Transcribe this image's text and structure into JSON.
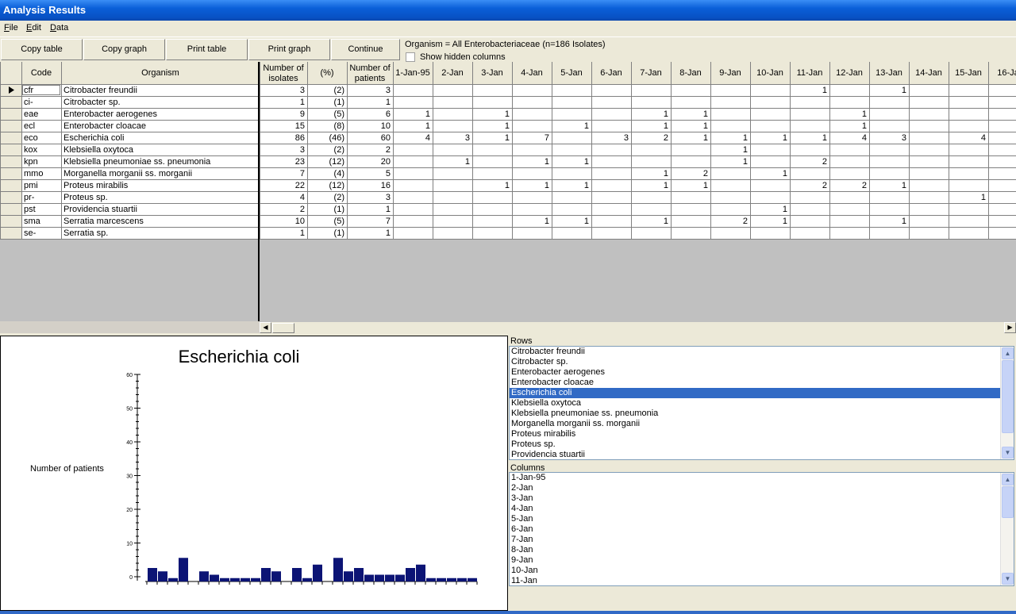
{
  "window": {
    "title": "Analysis Results"
  },
  "menu": [
    "File",
    "Edit",
    "Data"
  ],
  "toolbar": {
    "copy_table": "Copy table",
    "copy_graph": "Copy graph",
    "print_table": "Print table",
    "print_graph": "Print graph",
    "continue": "Continue",
    "organism_info": "Organism = All Enterobacteriaceae   (n=186 Isolates)",
    "show_hidden": "Show hidden columns"
  },
  "table": {
    "headers": {
      "code": "Code",
      "organism": "Organism",
      "isolates": [
        "Number of",
        "isolates"
      ],
      "pct": "(%)",
      "patients": [
        "Number of",
        "patients"
      ],
      "dates": [
        "1-Jan-95",
        "2-Jan",
        "3-Jan",
        "4-Jan",
        "5-Jan",
        "6-Jan",
        "7-Jan",
        "8-Jan",
        "9-Jan",
        "10-Jan",
        "11-Jan",
        "12-Jan",
        "13-Jan",
        "14-Jan",
        "15-Jan",
        "16-Ja"
      ]
    },
    "rows": [
      {
        "code": "cfr",
        "organism": "Citrobacter freundii",
        "isolates": "3",
        "pct": "(2)",
        "patients": "3",
        "dates": [
          "",
          "",
          "",
          "",
          "",
          "",
          "",
          "",
          "",
          "",
          "1",
          "",
          "1",
          "",
          "",
          ""
        ]
      },
      {
        "code": "ci-",
        "organism": "Citrobacter sp.",
        "isolates": "1",
        "pct": "(1)",
        "patients": "1",
        "dates": [
          "",
          "",
          "",
          "",
          "",
          "",
          "",
          "",
          "",
          "",
          "",
          "",
          "",
          "",
          "",
          ""
        ]
      },
      {
        "code": "eae",
        "organism": "Enterobacter aerogenes",
        "isolates": "9",
        "pct": "(5)",
        "patients": "6",
        "dates": [
          "1",
          "",
          "1",
          "",
          "",
          "",
          "1",
          "1",
          "",
          "",
          "",
          "1",
          "",
          "",
          "",
          ""
        ]
      },
      {
        "code": "ecl",
        "organism": "Enterobacter cloacae",
        "isolates": "15",
        "pct": "(8)",
        "patients": "10",
        "dates": [
          "1",
          "",
          "1",
          "",
          "1",
          "",
          "1",
          "1",
          "",
          "",
          "",
          "1",
          "",
          "",
          "",
          ""
        ]
      },
      {
        "code": "eco",
        "organism": "Escherichia coli",
        "isolates": "86",
        "pct": "(46)",
        "patients": "60",
        "dates": [
          "4",
          "3",
          "1",
          "7",
          "",
          "3",
          "2",
          "1",
          "1",
          "1",
          "1",
          "4",
          "3",
          "",
          "4",
          ""
        ]
      },
      {
        "code": "kox",
        "organism": "Klebsiella oxytoca",
        "isolates": "3",
        "pct": "(2)",
        "patients": "2",
        "dates": [
          "",
          "",
          "",
          "",
          "",
          "",
          "",
          "",
          "1",
          "",
          "",
          "",
          "",
          "",
          "",
          ""
        ]
      },
      {
        "code": "kpn",
        "organism": "Klebsiella pneumoniae ss. pneumonia",
        "isolates": "23",
        "pct": "(12)",
        "patients": "20",
        "dates": [
          "",
          "1",
          "",
          "1",
          "1",
          "",
          "",
          "",
          "1",
          "",
          "2",
          "",
          "",
          "",
          "",
          ""
        ]
      },
      {
        "code": "mmo",
        "organism": "Morganella morganii ss. morganii",
        "isolates": "7",
        "pct": "(4)",
        "patients": "5",
        "dates": [
          "",
          "",
          "",
          "",
          "",
          "",
          "1",
          "2",
          "",
          "1",
          "",
          "",
          "",
          "",
          "",
          ""
        ]
      },
      {
        "code": "pmi",
        "organism": "Proteus mirabilis",
        "isolates": "22",
        "pct": "(12)",
        "patients": "16",
        "dates": [
          "",
          "",
          "1",
          "1",
          "1",
          "",
          "1",
          "1",
          "",
          "",
          "2",
          "2",
          "1",
          "",
          "",
          ""
        ]
      },
      {
        "code": "pr-",
        "organism": "Proteus sp.",
        "isolates": "4",
        "pct": "(2)",
        "patients": "3",
        "dates": [
          "",
          "",
          "",
          "",
          "",
          "",
          "",
          "",
          "",
          "",
          "",
          "",
          "",
          "",
          "1",
          ""
        ]
      },
      {
        "code": "pst",
        "organism": "Providencia stuartii",
        "isolates": "2",
        "pct": "(1)",
        "patients": "1",
        "dates": [
          "",
          "",
          "",
          "",
          "",
          "",
          "",
          "",
          "",
          "1",
          "",
          "",
          "",
          "",
          "",
          ""
        ]
      },
      {
        "code": "sma",
        "organism": "Serratia marcescens",
        "isolates": "10",
        "pct": "(5)",
        "patients": "7",
        "dates": [
          "",
          "",
          "",
          "1",
          "1",
          "",
          "1",
          "",
          "2",
          "1",
          "",
          "",
          "1",
          "",
          "",
          ""
        ]
      },
      {
        "code": "se-",
        "organism": "Serratia sp.",
        "isolates": "1",
        "pct": "(1)",
        "patients": "1",
        "dates": [
          "",
          "",
          "",
          "",
          "",
          "",
          "",
          "",
          "",
          "",
          "",
          "",
          "",
          "",
          "",
          ""
        ]
      }
    ]
  },
  "chart_data": {
    "type": "bar",
    "title": "Escherichia coli",
    "ylabel": "Number of patients",
    "xlabel": "",
    "ylim": [
      0,
      60
    ],
    "yticks": [
      "0",
      "10",
      "20",
      "30",
      "40",
      "50",
      "60"
    ],
    "values": [
      4,
      3,
      1,
      7,
      0,
      3,
      2,
      1,
      1,
      1,
      1,
      4,
      3,
      0,
      4,
      1,
      5,
      0,
      7,
      3,
      4,
      2,
      2,
      2,
      2,
      4,
      5,
      1,
      1,
      1,
      1,
      1
    ],
    "bar_color": "#0c1475"
  },
  "rows_panel": {
    "label": "Rows",
    "items": [
      "Citrobacter freundii",
      "Citrobacter sp.",
      "Enterobacter aerogenes",
      "Enterobacter cloacae",
      "Escherichia coli",
      "Klebsiella oxytoca",
      "Klebsiella pneumoniae ss. pneumonia",
      "Morganella morganii ss. morganii",
      "Proteus mirabilis",
      "Proteus sp.",
      "Providencia stuartii"
    ],
    "selected": "Escherichia coli"
  },
  "columns_panel": {
    "label": "Columns",
    "items": [
      "1-Jan-95",
      "2-Jan",
      "3-Jan",
      "4-Jan",
      "5-Jan",
      "6-Jan",
      "7-Jan",
      "8-Jan",
      "9-Jan",
      "10-Jan",
      "11-Jan"
    ]
  },
  "colors": {
    "selection": "#316ac5",
    "titlebar": "#0a5fd8"
  }
}
